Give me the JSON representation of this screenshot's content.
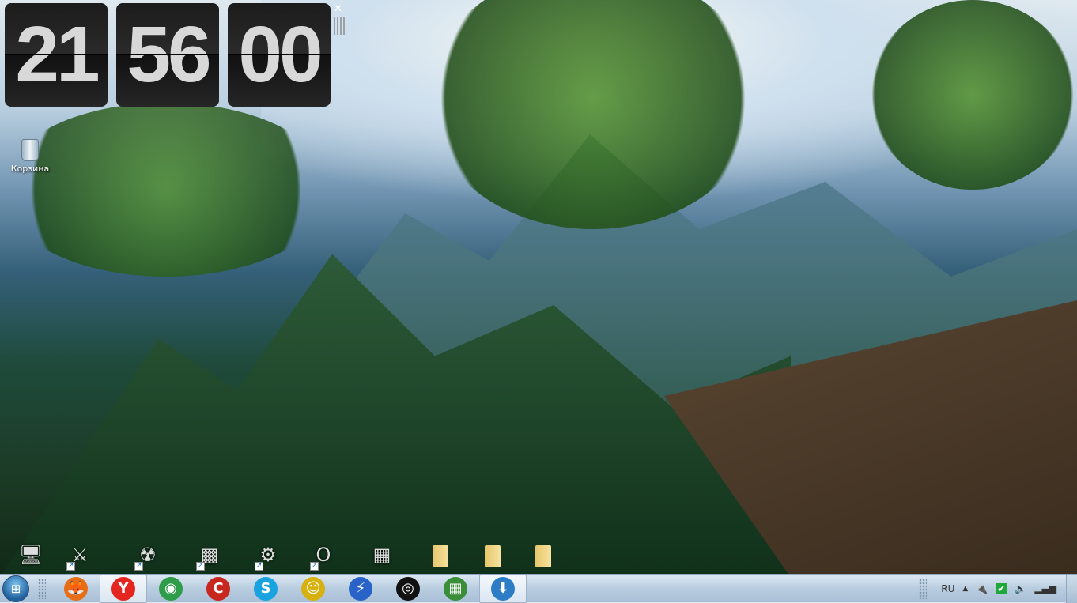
{
  "clock": {
    "hours": "21",
    "minutes": "56",
    "seconds": "00",
    "close": "✕"
  },
  "desktop": {
    "recycle_bin_label": "Корзина",
    "icons": [
      {
        "name": "computer-icon",
        "glyph": "🖥"
      },
      {
        "name": "game-shortcut-icon",
        "glyph": "⚔"
      },
      {
        "name": "stalker-shortcut-icon",
        "glyph": "☢"
      },
      {
        "name": "app-shortcut-icon",
        "glyph": "▩"
      },
      {
        "name": "game2-shortcut-icon",
        "glyph": "⚙"
      },
      {
        "name": "opera-shortcut-icon",
        "glyph": "O"
      },
      {
        "name": "network-card-icon",
        "glyph": "▦"
      },
      {
        "name": "folder-icon-1",
        "glyph": ""
      },
      {
        "name": "folder-icon-2",
        "glyph": ""
      },
      {
        "name": "folder-icon-3",
        "glyph": ""
      }
    ]
  },
  "taskbar": {
    "start_glyph": "⊞",
    "apps": [
      {
        "name": "firefox",
        "glyph": "🦊",
        "color": "#e76e16"
      },
      {
        "name": "yandex-browser",
        "glyph": "Y",
        "color": "#e52620"
      },
      {
        "name": "chrome",
        "glyph": "◉",
        "color": "#2e9c49"
      },
      {
        "name": "ccleaner",
        "glyph": "C",
        "color": "#c7271d"
      },
      {
        "name": "skype",
        "glyph": "S",
        "color": "#18a2e0"
      },
      {
        "name": "webmoney-agent",
        "glyph": "☺",
        "color": "#d6b10f"
      },
      {
        "name": "daemon-tools",
        "glyph": "⚡",
        "color": "#2a63c8"
      },
      {
        "name": "webcam",
        "glyph": "◎",
        "color": "#111111"
      },
      {
        "name": "network-card",
        "glyph": "▦",
        "color": "#3a8e3a"
      },
      {
        "name": "downloader",
        "glyph": "⬇",
        "color": "#2d7dc6"
      }
    ],
    "tray": {
      "language": "RU",
      "expand": "▲"
    }
  }
}
